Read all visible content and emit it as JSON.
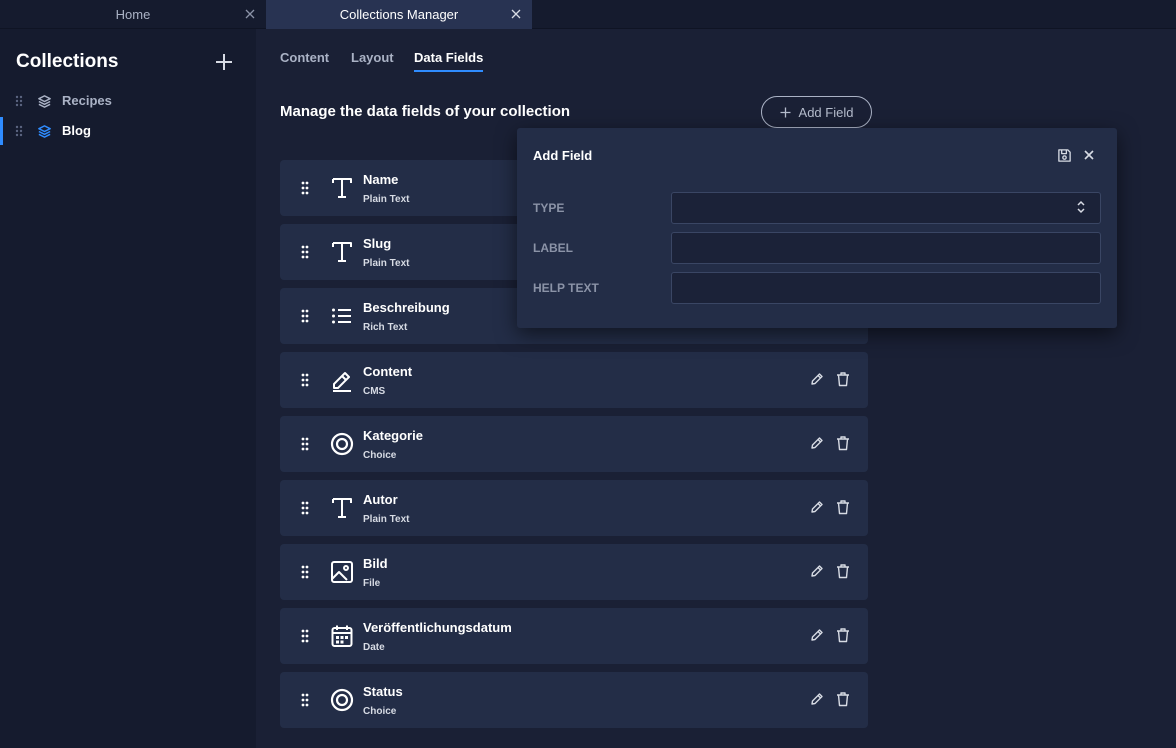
{
  "tabs": [
    {
      "label": "Home"
    },
    {
      "label": "Collections Manager"
    }
  ],
  "sidebar": {
    "title": "Collections",
    "items": [
      {
        "label": "Recipes"
      },
      {
        "label": "Blog"
      }
    ]
  },
  "content_tabs": [
    {
      "label": "Content"
    },
    {
      "label": "Layout"
    },
    {
      "label": "Data Fields"
    }
  ],
  "main": {
    "heading": "Manage the data fields of your collection",
    "add_field_label": "Add Field"
  },
  "fields": [
    {
      "name": "Name",
      "type": "Plain Text",
      "icon": "text-icon"
    },
    {
      "name": "Slug",
      "type": "Plain Text",
      "icon": "text-icon"
    },
    {
      "name": "Beschreibung",
      "type": "Rich Text",
      "icon": "list-icon"
    },
    {
      "name": "Content",
      "type": "CMS",
      "icon": "pencil-icon"
    },
    {
      "name": "Kategorie",
      "type": "Choice",
      "icon": "target-icon"
    },
    {
      "name": "Autor",
      "type": "Plain Text",
      "icon": "text-icon"
    },
    {
      "name": "Bild",
      "type": "File",
      "icon": "image-icon"
    },
    {
      "name": "Veröffentlichungsdatum",
      "type": "Date",
      "icon": "calendar-icon"
    },
    {
      "name": "Status",
      "type": "Choice",
      "icon": "target-icon"
    }
  ],
  "popup": {
    "title": "Add Field",
    "type_label": "TYPE",
    "type_value": "",
    "label_label": "LABEL",
    "label_value": "",
    "help_label": "HELP TEXT",
    "help_value": ""
  },
  "colors": {
    "accent": "#2f8cff",
    "background": "#1a2035",
    "panel": "#232d47",
    "sidebar": "#151b2e"
  }
}
